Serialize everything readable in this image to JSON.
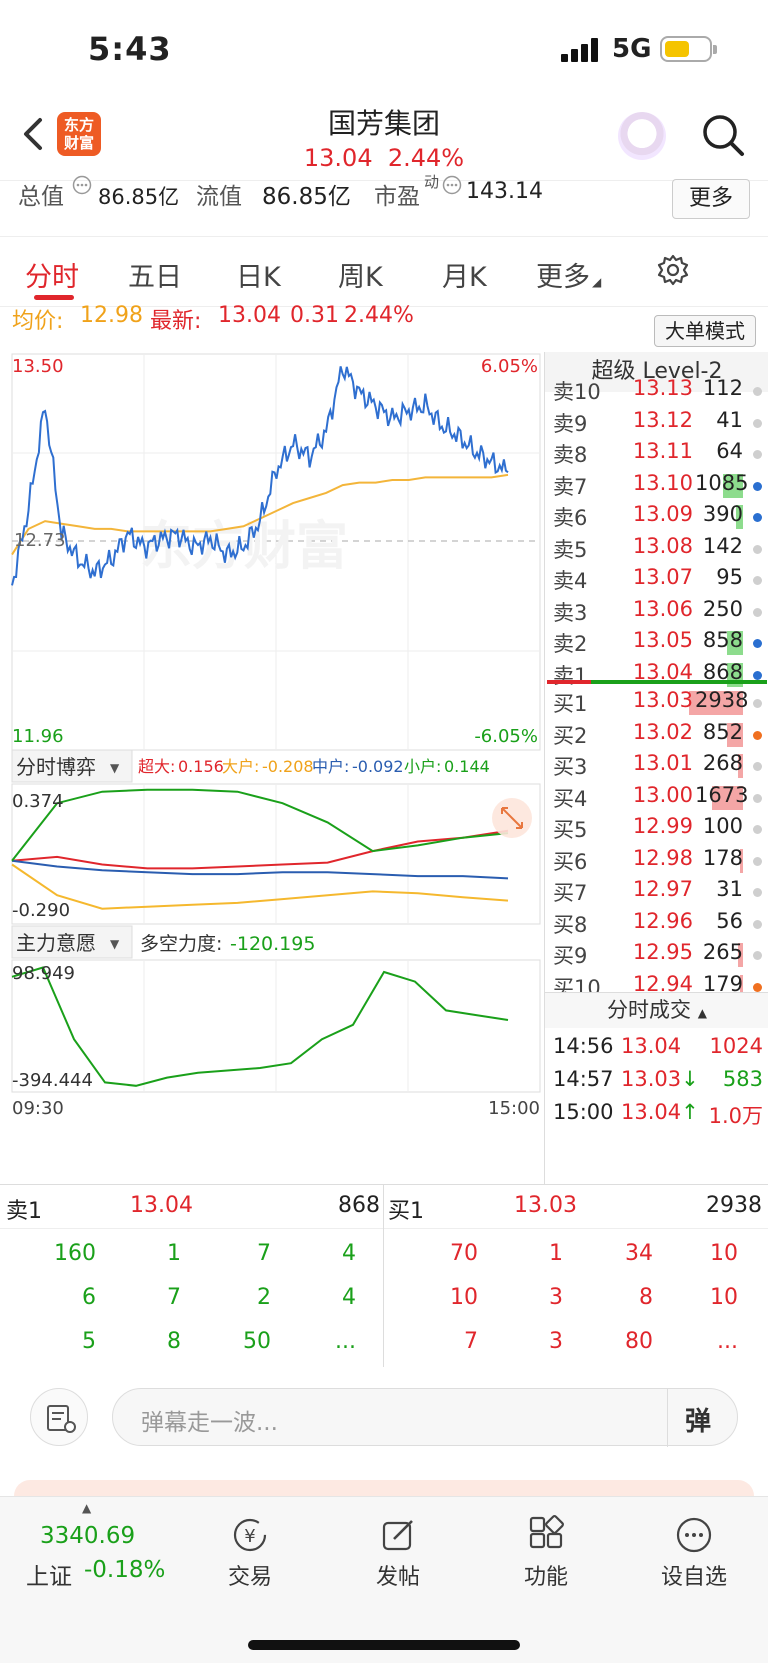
{
  "status": {
    "time": "5:43",
    "network": "5G"
  },
  "header": {
    "logo_line1": "东方",
    "logo_line2": "财富",
    "name": "国芳集团",
    "price": "13.04",
    "change_pct": "2.44%"
  },
  "stats": {
    "total_label": "总值",
    "total_value": "86.85亿",
    "float_label": "流值",
    "float_value": "86.85亿",
    "pe_label": "市盈",
    "pe_sup": "动",
    "pe_value": "143.14",
    "more": "更多"
  },
  "tabs": [
    "分时",
    "五日",
    "日K",
    "周K",
    "月K",
    "更多"
  ],
  "infobar": {
    "avg_label": "均价:",
    "avg_value": "12.98",
    "latest_label": "最新:",
    "latest_value": "13.04",
    "change": "0.31",
    "change_pct": "2.44%",
    "mode_button": "大单模式"
  },
  "main_chart": {
    "ymax": "13.50",
    "ymin": "11.96",
    "mid": "12.73",
    "pct_max": "6.05%",
    "pct_min": "-6.05%",
    "watermark": "东方财富"
  },
  "bo_chart": {
    "selector": "分时博弈",
    "l1": "超大:",
    "v1": "0.156",
    "l2": "大户:",
    "v2": "-0.208",
    "l3": "中户:",
    "v3": "-0.092",
    "l4": "小户:",
    "v4": "0.144",
    "ymax": "0.374",
    "ymin": "-0.290"
  },
  "main_force": {
    "selector": "主力意愿",
    "label": "多空力度:",
    "value": "-120.195",
    "ymax": "98.949",
    "ymin": "-394.444",
    "t_start": "09:30",
    "t_end": "15:00"
  },
  "chart_data": [
    {
      "type": "line",
      "title": "分时",
      "x": [
        "09:30",
        "15:00"
      ],
      "ylim": [
        11.96,
        13.5
      ],
      "series": [
        {
          "name": "最新",
          "values": [
            12.6,
            12.9,
            13.3,
            12.8,
            12.7,
            12.65,
            12.7,
            12.8,
            12.75,
            12.78,
            12.8,
            12.75,
            12.78,
            12.72,
            12.75,
            12.85,
            13.05,
            13.15,
            13.1,
            13.2,
            13.45,
            13.35,
            13.3,
            13.25,
            13.28,
            13.3,
            13.22,
            13.18,
            13.12,
            13.08,
            13.04
          ]
        },
        {
          "name": "均价",
          "values": [
            12.72,
            12.82,
            12.85,
            12.84,
            12.83,
            12.82,
            12.82,
            12.81,
            12.81,
            12.81,
            12.81,
            12.81,
            12.81,
            12.82,
            12.83,
            12.86,
            12.89,
            12.92,
            12.94,
            12.96,
            12.99,
            13.0,
            13.0,
            13.01,
            13.01,
            13.02,
            13.02,
            13.02,
            13.02,
            13.02,
            13.03
          ]
        }
      ]
    },
    {
      "type": "line",
      "title": "分时博弈",
      "x": [
        "09:30",
        "15:00"
      ],
      "ylim": [
        -0.29,
        0.374
      ],
      "series": [
        {
          "name": "超大",
          "values": [
            0.0,
            0.02,
            -0.02,
            -0.04,
            -0.04,
            -0.03,
            -0.02,
            -0.01,
            0.05,
            0.1,
            0.12,
            0.156
          ]
        },
        {
          "name": "大户",
          "values": [
            -0.02,
            -0.18,
            -0.25,
            -0.24,
            -0.23,
            -0.22,
            -0.2,
            -0.18,
            -0.16,
            -0.17,
            -0.19,
            -0.208
          ]
        },
        {
          "name": "中户",
          "values": [
            0.0,
            -0.03,
            -0.05,
            -0.06,
            -0.07,
            -0.07,
            -0.06,
            -0.06,
            -0.07,
            -0.08,
            -0.08,
            -0.092
          ]
        },
        {
          "name": "小户",
          "values": [
            0.0,
            0.3,
            0.36,
            0.37,
            0.37,
            0.36,
            0.3,
            0.2,
            0.05,
            0.08,
            0.12,
            0.144
          ]
        }
      ]
    },
    {
      "type": "line",
      "title": "主力意愿",
      "x": [
        "09:30",
        "15:00"
      ],
      "ylim": [
        -394.444,
        98.949
      ],
      "series": [
        {
          "name": "多空力度",
          "values": [
            60,
            98.9,
            -200,
            -380,
            -394,
            -360,
            -340,
            -330,
            -320,
            -300,
            -200,
            -140,
            80,
            40,
            -80,
            -100,
            -120.195
          ]
        }
      ]
    }
  ],
  "book": {
    "title": "超级 Level-2",
    "asks": [
      {
        "n": "卖10",
        "p": "13.13",
        "v": "112",
        "dot": "#cfcfcf",
        "bar": 0
      },
      {
        "n": "卖9",
        "p": "13.12",
        "v": "41",
        "dot": "#cfcfcf",
        "bar": 0
      },
      {
        "n": "卖8",
        "p": "13.11",
        "v": "64",
        "dot": "#cfcfcf",
        "bar": 0
      },
      {
        "n": "卖7",
        "p": "13.10",
        "v": "1085",
        "dot": "#2a6fd0",
        "bar": 0.37
      },
      {
        "n": "卖6",
        "p": "13.09",
        "v": "390",
        "dot": "#2a6fd0",
        "bar": 0.13
      },
      {
        "n": "卖5",
        "p": "13.08",
        "v": "142",
        "dot": "#cfcfcf",
        "bar": 0
      },
      {
        "n": "卖4",
        "p": "13.07",
        "v": "95",
        "dot": "#cfcfcf",
        "bar": 0
      },
      {
        "n": "卖3",
        "p": "13.06",
        "v": "250",
        "dot": "#cfcfcf",
        "bar": 0
      },
      {
        "n": "卖2",
        "p": "13.05",
        "v": "858",
        "dot": "#2a6fd0",
        "bar": 0.29
      },
      {
        "n": "卖1",
        "p": "13.04",
        "v": "868",
        "dot": "#2a6fd0",
        "bar": 0.3
      }
    ],
    "bids": [
      {
        "n": "买1",
        "p": "13.03",
        "v": "2938",
        "dot": "#cfcfcf",
        "bar": 1.0
      },
      {
        "n": "买2",
        "p": "13.02",
        "v": "852",
        "dot": "#f07020",
        "bar": 0.29
      },
      {
        "n": "买3",
        "p": "13.01",
        "v": "268",
        "dot": "#cfcfcf",
        "bar": 0.09
      },
      {
        "n": "买4",
        "p": "13.00",
        "v": "1673",
        "dot": "#cfcfcf",
        "bar": 0.57
      },
      {
        "n": "买5",
        "p": "12.99",
        "v": "100",
        "dot": "#cfcfcf",
        "bar": 0
      },
      {
        "n": "买6",
        "p": "12.98",
        "v": "178",
        "dot": "#cfcfcf",
        "bar": 0.06
      },
      {
        "n": "买7",
        "p": "12.97",
        "v": "31",
        "dot": "#cfcfcf",
        "bar": 0
      },
      {
        "n": "买8",
        "p": "12.96",
        "v": "56",
        "dot": "#cfcfcf",
        "bar": 0
      },
      {
        "n": "买9",
        "p": "12.95",
        "v": "265",
        "dot": "#cfcfcf",
        "bar": 0.09
      },
      {
        "n": "买10",
        "p": "12.94",
        "v": "179",
        "dot": "#f07020",
        "bar": 0.06
      }
    ],
    "trades_title": "分时成交",
    "trades": [
      {
        "t": "14:56",
        "p": "13.04",
        "arrow": "",
        "v": "1024",
        "pc": "#e0262c",
        "vc": "#e0262c"
      },
      {
        "t": "14:57",
        "p": "13.03",
        "arrow": "↓",
        "v": "583",
        "pc": "#e0262c",
        "vc": "#1aa01a"
      },
      {
        "t": "15:00",
        "p": "13.04",
        "arrow": "↑",
        "v": "1.0万",
        "pc": "#e0262c",
        "vc": "#e0262c"
      }
    ]
  },
  "depth": {
    "sell_label": "卖1",
    "sell_price": "13.04",
    "sell_vol": "868",
    "buy_label": "买1",
    "buy_price": "13.03",
    "buy_vol": "2938",
    "sell_queue": [
      [
        "160",
        "1",
        "7",
        "4"
      ],
      [
        "6",
        "7",
        "2",
        "4"
      ],
      [
        "5",
        "8",
        "50",
        "..."
      ]
    ],
    "buy_queue": [
      [
        "70",
        "1",
        "34",
        "10"
      ],
      [
        "10",
        "3",
        "8",
        "10"
      ],
      [
        "7",
        "3",
        "80",
        "..."
      ]
    ]
  },
  "comment": {
    "placeholder": "弹幕走一波...",
    "danmu_btn": "弹"
  },
  "nav": {
    "index_value": "3340.69",
    "index_name": "上证",
    "index_pct": "-0.18%",
    "trade": "交易",
    "post": "发帖",
    "func": "功能",
    "watch": "设自选"
  }
}
